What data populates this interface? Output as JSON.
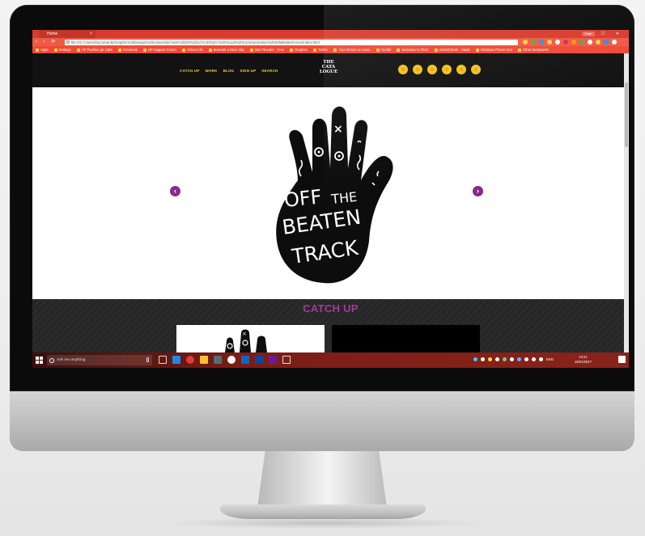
{
  "browser": {
    "tab_title": "Home",
    "tab_close": "×",
    "window_controls": "– ☐ ✕",
    "user_chip": "Mark",
    "nav_buttons": "‹ › ⟳",
    "url": "file:///C:/Users/Documents/Graphic%20Design%20University/Year%202/3%20LOAAD%20-%20Visual%20Communication%202/Website/Home/index.html",
    "bookmarks": [
      "Apps",
      "Settings",
      "HP Pavilion g6 1369",
      "Facebook",
      "HP Support Forum",
      "Yahoo! UK",
      "Beneath a Steel Sky",
      "War Thunder - Free",
      "Dropbox",
      "Twitter",
      "Your stream on Soun",
      "Tumblr",
      "Welcome to Flickr",
      "GridUCDesk - Stude",
      "Windows Phone Cen",
      "Other bookmarks"
    ],
    "colors": {
      "tabbar": "#d63c2e",
      "addrbar": "#ef5a45"
    }
  },
  "site": {
    "logo_line1": "THE",
    "logo_line2": "CATA",
    "logo_line3": "LOGUE",
    "nav": [
      "CATCH UP",
      "WORK",
      "BLOG",
      "SIGN UP",
      "SEARCH"
    ],
    "social_icons": [
      "social-icon-1",
      "social-icon-2",
      "social-icon-3",
      "social-icon-4",
      "social-icon-5",
      "social-icon-6"
    ],
    "slider": {
      "prev": "‹",
      "next": "›",
      "hand_text": [
        "OFF",
        "THE",
        "BEATEN",
        "TRACK"
      ]
    },
    "section_title": "CATCH UP",
    "colors": {
      "accent": "#a23c97",
      "nav": "#f2d12c",
      "social": "#f2c11f"
    }
  },
  "taskbar": {
    "search_placeholder": "Ask me anything",
    "clock_time": "13:21",
    "clock_date": "16/01/2017",
    "lang": "ENG"
  }
}
